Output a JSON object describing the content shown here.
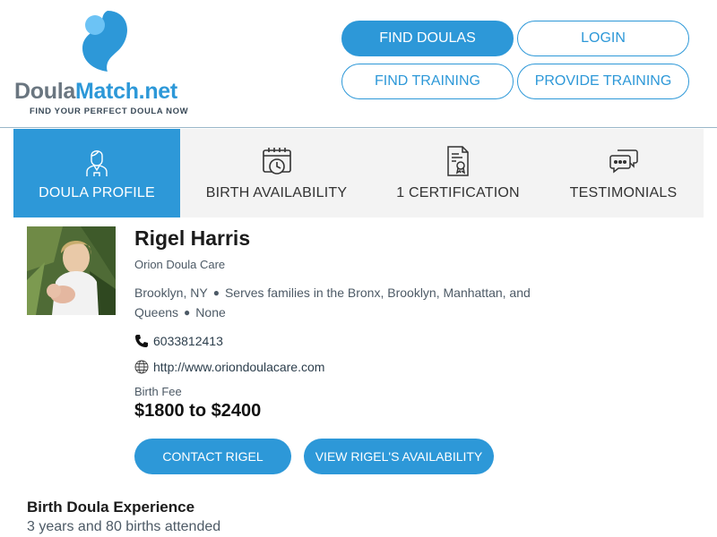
{
  "brand": {
    "name_part1": "Doula",
    "name_part2": "Match.net",
    "tagline": "FIND YOUR PERFECT DOULA NOW",
    "accent_color": "#2d98d8"
  },
  "header": {
    "buttons": [
      {
        "label": "FIND DOULAS",
        "style": "filled"
      },
      {
        "label": "LOGIN",
        "style": "outline"
      },
      {
        "label": "FIND TRAINING",
        "style": "outline"
      },
      {
        "label": "PROVIDE TRAINING",
        "style": "outline"
      }
    ]
  },
  "tabs": [
    {
      "label": "DOULA PROFILE",
      "icon": "doula-person-icon",
      "active": true
    },
    {
      "label": "BIRTH AVAILABILITY",
      "icon": "calendar-clock-icon",
      "active": false
    },
    {
      "label": "1 CERTIFICATION",
      "icon": "certificate-document-icon",
      "active": false
    },
    {
      "label": "TESTIMONIALS",
      "icon": "chat-bubbles-icon",
      "active": false
    }
  ],
  "profile": {
    "name": "Rigel Harris",
    "agency": "Orion Doula Care",
    "location": "Brooklyn, NY",
    "service_area": "Serves families in the Bronx, Brooklyn, Manhattan, and",
    "service_area_cont": "Queens",
    "extra": "None",
    "phone": "6033812413",
    "website": "http://www.oriondoulacare.com",
    "fee_label": "Birth Fee",
    "fee_value": "$1800 to $2400",
    "contact_button": "CONTACT RIGEL",
    "availability_button": "VIEW RIGEL'S AVAILABILITY"
  },
  "experience": {
    "title": "Birth Doula Experience",
    "text": "3 years and 80 births attended"
  }
}
